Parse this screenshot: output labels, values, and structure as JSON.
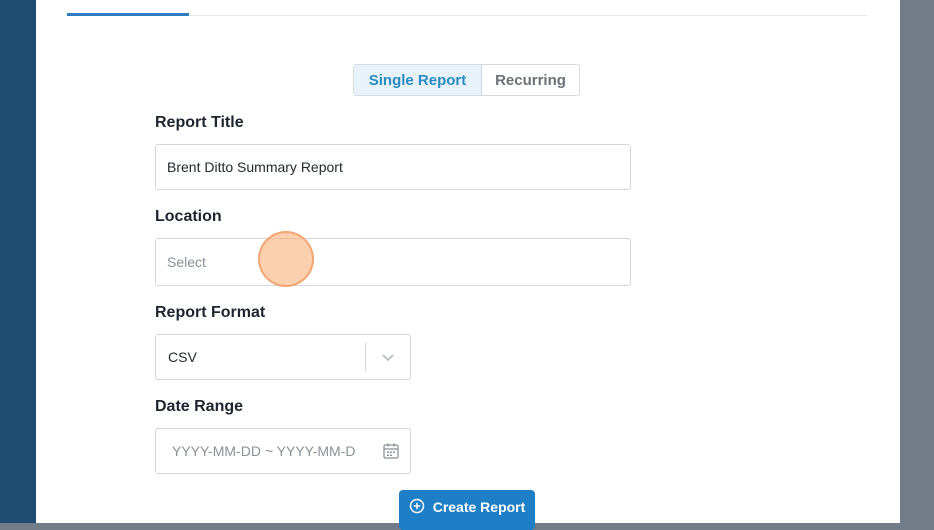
{
  "report_type_toggle": {
    "single_label": "Single Report",
    "recurring_label": "Recurring"
  },
  "form": {
    "report_title": {
      "label": "Report Title",
      "value": "Brent Ditto Summary Report"
    },
    "location": {
      "label": "Location",
      "placeholder": "Select"
    },
    "report_format": {
      "label": "Report Format",
      "value": "CSV"
    },
    "date_range": {
      "label": "Date Range",
      "placeholder": "YYYY-MM-DD ~ YYYY-MM-D"
    }
  },
  "actions": {
    "create_label": "Create Report"
  },
  "icons": {
    "format_dropdown": "chevron-down-icon",
    "date_picker": "calendar-icon",
    "create": "plus-circle-icon"
  },
  "colors": {
    "accent": "#1f7fc6",
    "toggle_active_text": "#2b8ac0",
    "left_band": "#1f4c72",
    "cursor_highlight": "#f5a66e"
  }
}
